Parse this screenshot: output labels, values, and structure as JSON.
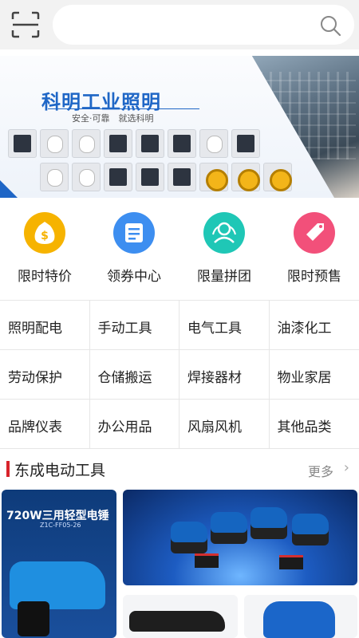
{
  "search": {
    "placeholder": ""
  },
  "banner": {
    "title": "科明工业照明",
    "subtitle": "安全·可靠　就选科明"
  },
  "quick_entries": [
    {
      "label": "限时特价",
      "icon": "dollar-bag-icon",
      "color": "#f6b300"
    },
    {
      "label": "领券中心",
      "icon": "coupon-icon",
      "color": "#3d8ef0"
    },
    {
      "label": "限量拼团",
      "icon": "group-icon",
      "color": "#1fc7b6"
    },
    {
      "label": "限时预售",
      "icon": "tag-icon",
      "color": "#f2507a"
    }
  ],
  "categories": [
    [
      "照明配电",
      "手动工具",
      "电气工具",
      "油漆化工"
    ],
    [
      "劳动保护",
      "仓储搬运",
      "焊接器材",
      "物业家居"
    ],
    [
      "品牌仪表",
      "办公用品",
      "风扇风机",
      "其他品类"
    ]
  ],
  "section": {
    "title": "东成电动工具",
    "more": "更多"
  },
  "products": {
    "card1_title": "720W三用轻型电锤",
    "card1_model": "Z1C-FF05-26"
  }
}
